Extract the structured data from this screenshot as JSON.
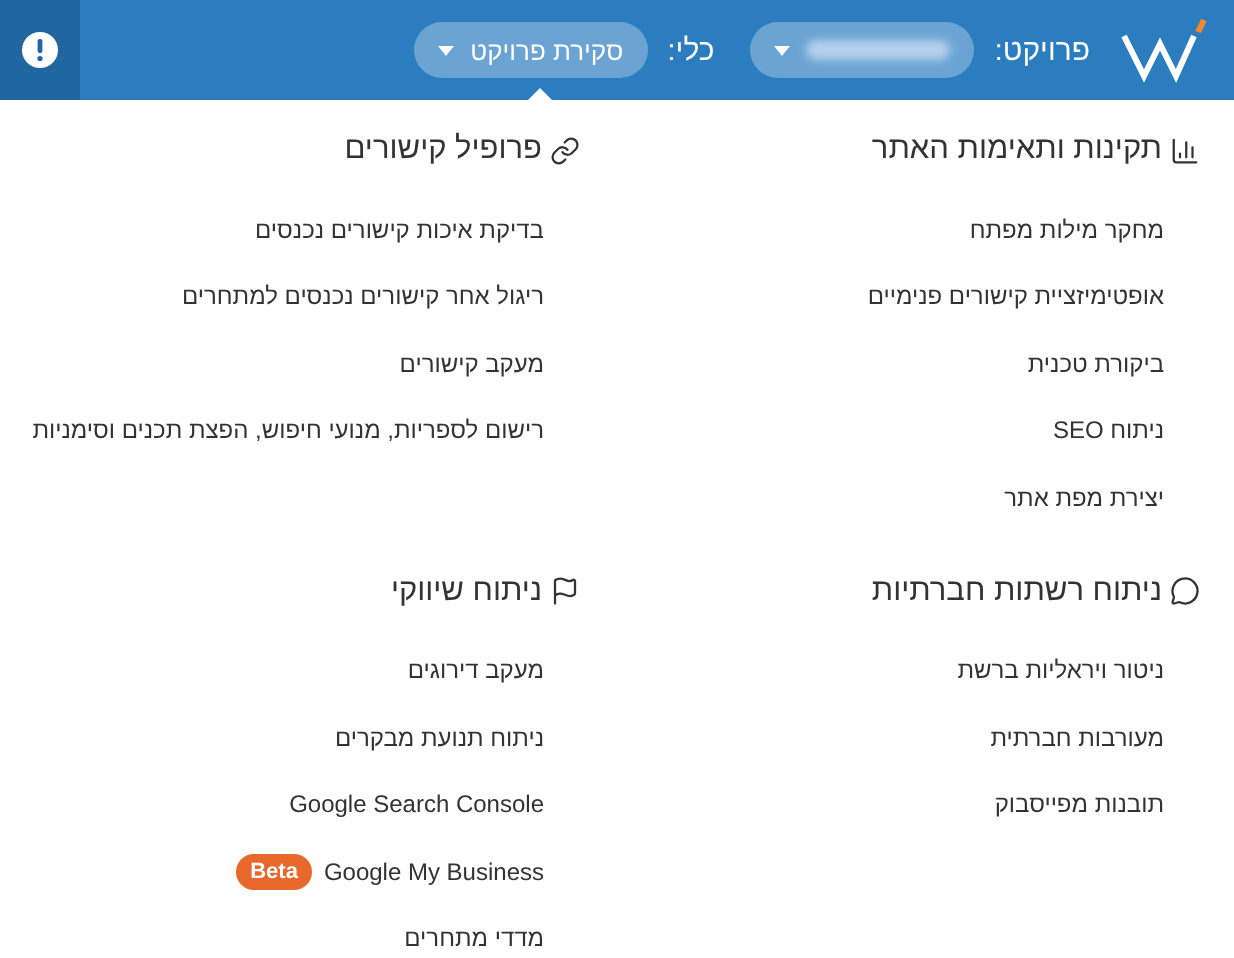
{
  "header": {
    "project_label": "פרויקט:",
    "project_value_obscured": true,
    "tool_label": "כלי:",
    "tool_value": "סקירת פרויקט"
  },
  "sections": [
    {
      "title": "תקינות ותאימות האתר",
      "items": [
        {
          "label": "מחקר מילות מפתח"
        },
        {
          "label": "אופטימיזציית קישורים פנימיים"
        },
        {
          "label": "ביקורת טכנית"
        },
        {
          "label": "ניתוח SEO"
        },
        {
          "label": "יצירת מפת אתר"
        }
      ]
    },
    {
      "title": "פרופיל קישורים",
      "items": [
        {
          "label": "בדיקת איכות קישורים נכנסים"
        },
        {
          "label": "ריגול אחר קישורים נכנסים למתחרים"
        },
        {
          "label": "מעקב קישורים"
        },
        {
          "label": "רישום לספריות, מנועי חיפוש, הפצת תכנים וסימניות"
        }
      ]
    },
    {
      "title": "ניתוח רשתות חברתיות",
      "items": [
        {
          "label": "ניטור ויראליות ברשת"
        },
        {
          "label": "מעורבות חברתית"
        },
        {
          "label": "תובנות מפייסבוק"
        }
      ]
    },
    {
      "title": "ניתוח שיווקי",
      "items": [
        {
          "label": "מעקב דירוגים"
        },
        {
          "label": "ניתוח תנועת מבקרים"
        },
        {
          "label": "Google Search Console"
        },
        {
          "label": "Google My Business",
          "badge": "Beta"
        },
        {
          "label": "מדדי מתחרים"
        }
      ]
    }
  ]
}
